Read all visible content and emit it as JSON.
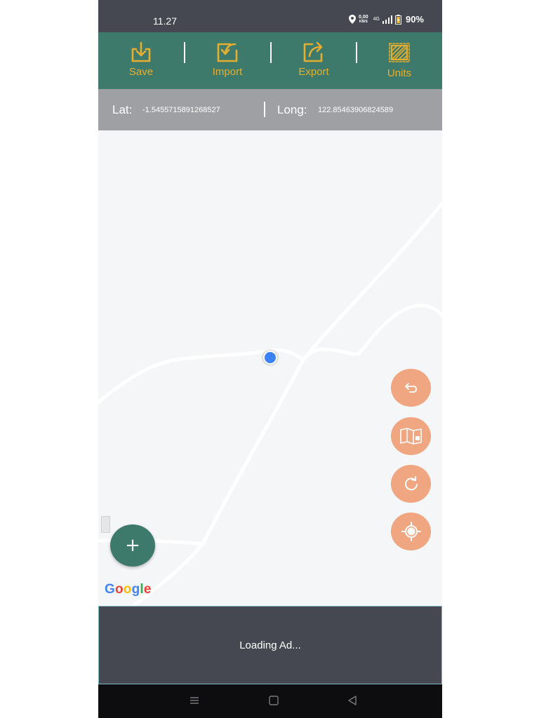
{
  "status_bar": {
    "time": "11.27",
    "net_speed_value": "0,00",
    "net_speed_unit": "KB/S",
    "net_type": "4G",
    "battery": "90%"
  },
  "toolbar": {
    "items": [
      {
        "label": "Save",
        "icon": "save-download-icon"
      },
      {
        "label": "Import",
        "icon": "import-icon"
      },
      {
        "label": "Export",
        "icon": "export-share-icon"
      },
      {
        "label": "Units",
        "icon": "units-area-icon"
      }
    ]
  },
  "coords": {
    "lat_label": "Lat:",
    "lat_value": "-1.5455715891268527",
    "long_label": "Long:",
    "long_value": "122.85463906824589"
  },
  "map": {
    "attribution": "Google",
    "buttons": [
      {
        "name": "undo-button",
        "icon": "undo-icon"
      },
      {
        "name": "map-type-button",
        "icon": "map-icon"
      },
      {
        "name": "refresh-button",
        "icon": "refresh-icon"
      },
      {
        "name": "my-location-button",
        "icon": "gps-target-icon"
      }
    ],
    "add_button": "+"
  },
  "ad": {
    "text": "Loading Ad..."
  },
  "colors": {
    "toolbar_bg": "#3e7a6b",
    "toolbar_label": "#e6ae2e",
    "fab_orange": "#f0a680",
    "fab_green": "#3e7a6b",
    "status_bar_bg": "#454850",
    "coord_bar_bg": "#9ea0a4"
  }
}
